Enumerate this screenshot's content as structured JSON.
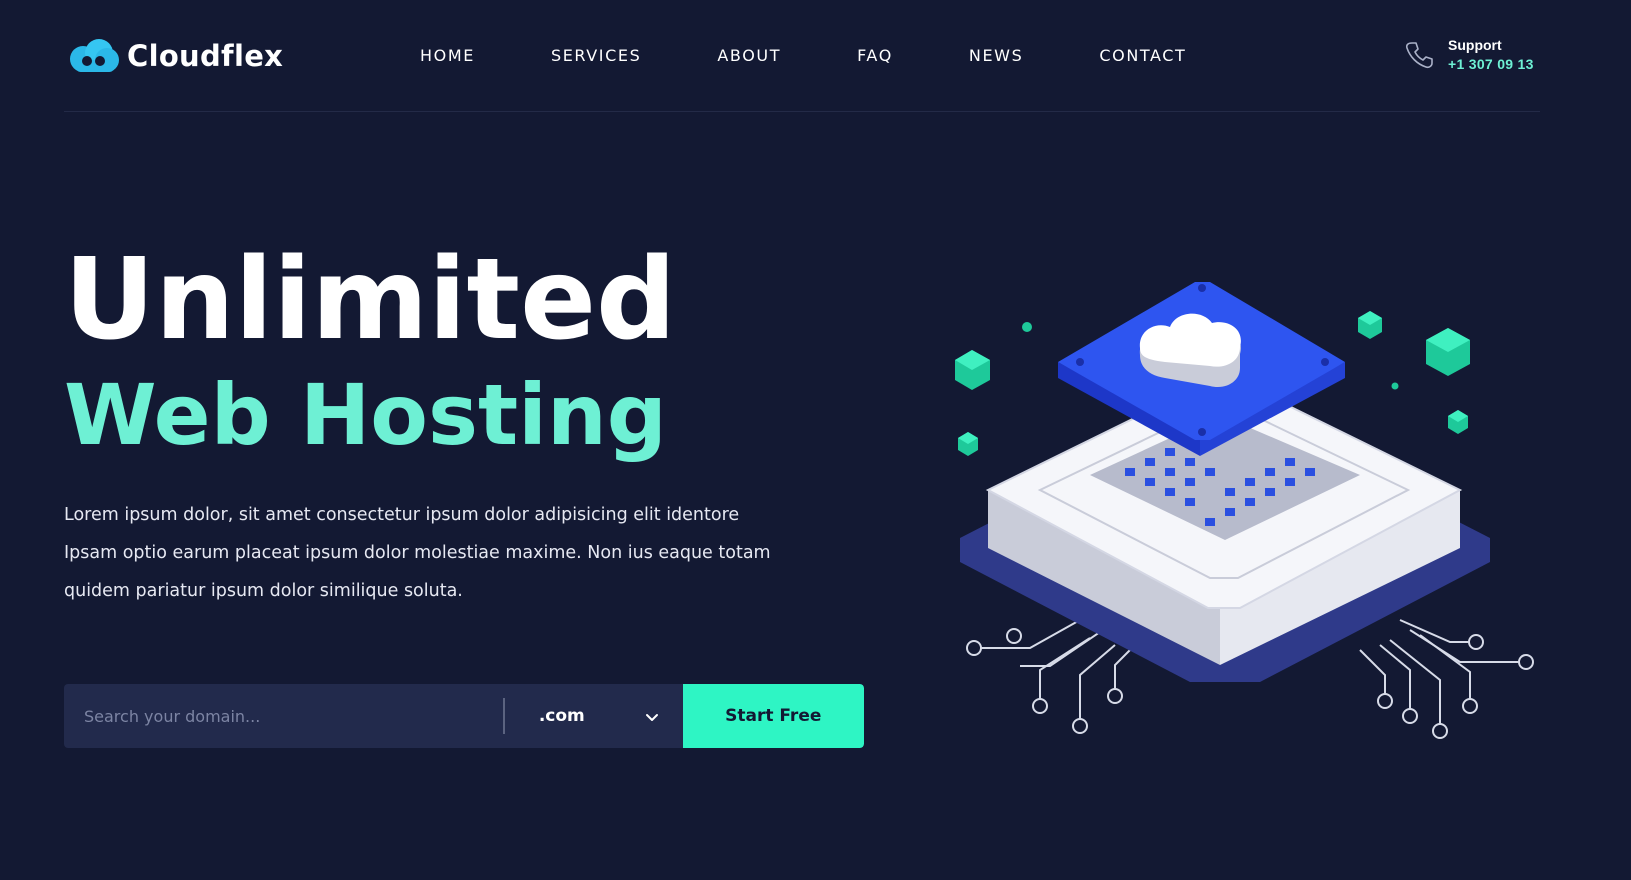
{
  "brand": {
    "name": "Cloudflex",
    "accent": "#6ef0d4",
    "background": "#131933",
    "button_color": "#2ef5c4",
    "logo_icon": "cloud-icon"
  },
  "nav": {
    "items": [
      {
        "label": "HOME"
      },
      {
        "label": "SERVICES"
      },
      {
        "label": "ABOUT"
      },
      {
        "label": "FAQ"
      },
      {
        "label": "NEWS"
      },
      {
        "label": "CONTACT"
      }
    ]
  },
  "support": {
    "label": "Support",
    "phone": "+1 307 09 13",
    "icon": "phone-icon"
  },
  "hero": {
    "title_line1": "Unlimited",
    "title_line2": "Web Hosting",
    "description": "Lorem ipsum dolor, sit amet consectetur ipsum dolor adipisicing elit identore Ipsam optio earum placeat ipsum dolor molestiae maxime. Non ius eaque totam quidem pariatur ipsum dolor similique soluta."
  },
  "domain_search": {
    "placeholder": "Search your domain...",
    "tld_selected": ".com",
    "button_label": "Start Free"
  }
}
